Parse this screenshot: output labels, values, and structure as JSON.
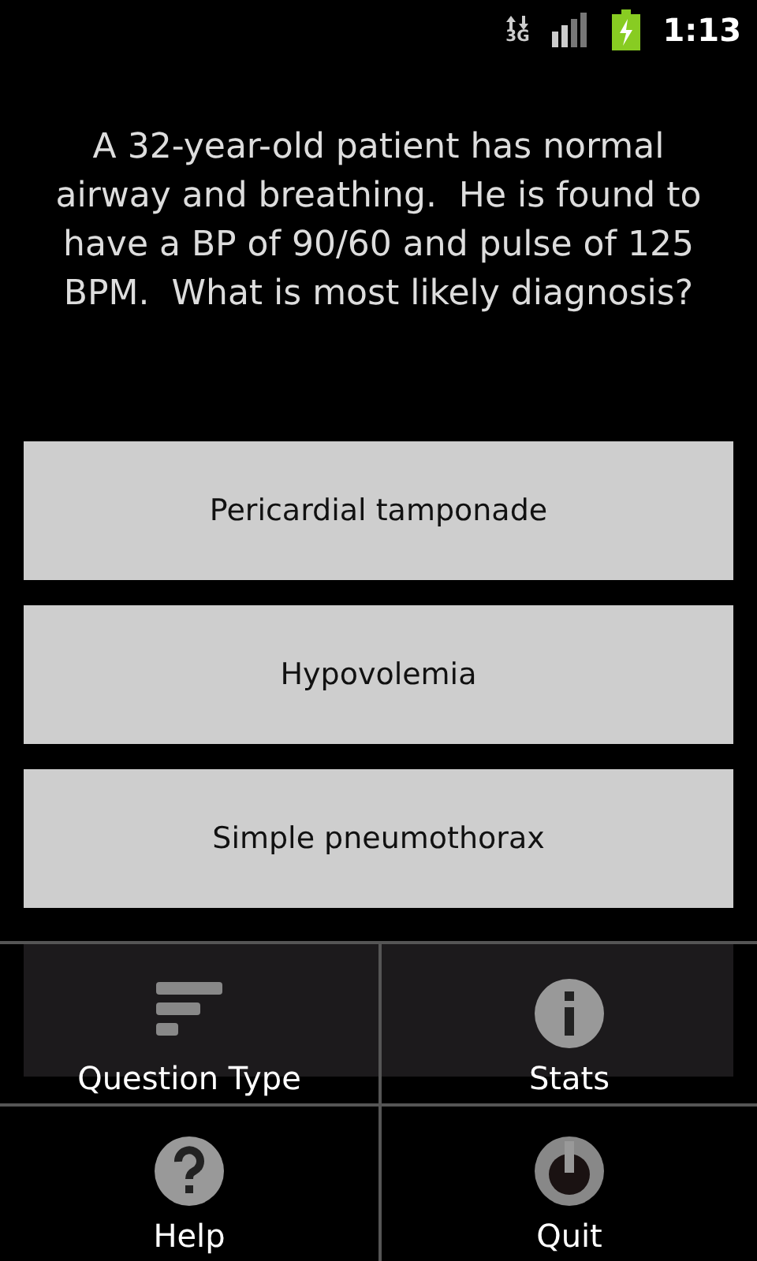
{
  "status_bar": {
    "network": "3G",
    "time": "1:13"
  },
  "question": "A 32-year-old patient has normal airway and breathing.  He is found to have a BP of 90/60 and pulse of 125 BPM.  What is most likely diagnosis?",
  "answers": [
    {
      "label": "Pericardial tamponade"
    },
    {
      "label": "Hypovolemia"
    },
    {
      "label": "Simple pneumothorax"
    }
  ],
  "menu": [
    {
      "label": "Question Type",
      "kind": "type"
    },
    {
      "label": "Stats",
      "kind": "info"
    },
    {
      "label": "Help",
      "kind": "help"
    },
    {
      "label": "Quit",
      "kind": "power"
    }
  ]
}
